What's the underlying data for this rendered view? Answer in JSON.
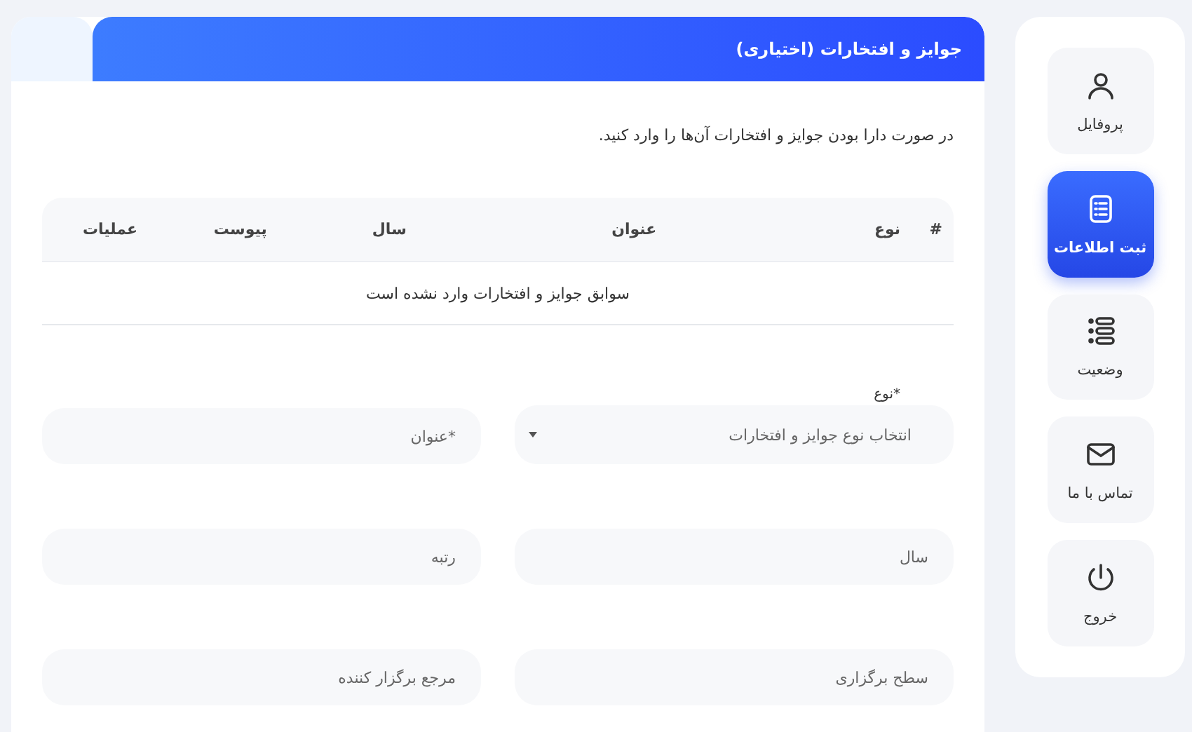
{
  "sidebar": {
    "items": [
      {
        "label": "پروفایل",
        "selected": false
      },
      {
        "label": "ثبت اطلاعات",
        "selected": true
      },
      {
        "label": "وضعیت",
        "selected": false
      },
      {
        "label": "تماس با ما",
        "selected": false
      },
      {
        "label": "خروج",
        "selected": false
      }
    ]
  },
  "panel": {
    "title": "جوایز و افتخارات (اختیاری)",
    "intro": "در صورت دارا بودن جوایز و افتخارات آن‌ها را وارد کنید."
  },
  "table": {
    "columns": [
      "#",
      "نوع",
      "عنوان",
      "سال",
      "پیوست",
      "عملیات"
    ],
    "empty_message": "سوابق جوایز و افتخارات وارد نشده است"
  },
  "form": {
    "fields": [
      {
        "kind": "select",
        "label": "*نوع",
        "placeholder": "انتخاب نوع جوایز و افتخارات"
      },
      {
        "kind": "input",
        "placeholder": "*عنوان"
      },
      {
        "kind": "input",
        "placeholder": "سال"
      },
      {
        "kind": "input",
        "placeholder": "رتبه"
      },
      {
        "kind": "input",
        "placeholder": "سطح برگزاری"
      },
      {
        "kind": "input",
        "placeholder": "مرجع برگزار کننده"
      }
    ]
  }
}
